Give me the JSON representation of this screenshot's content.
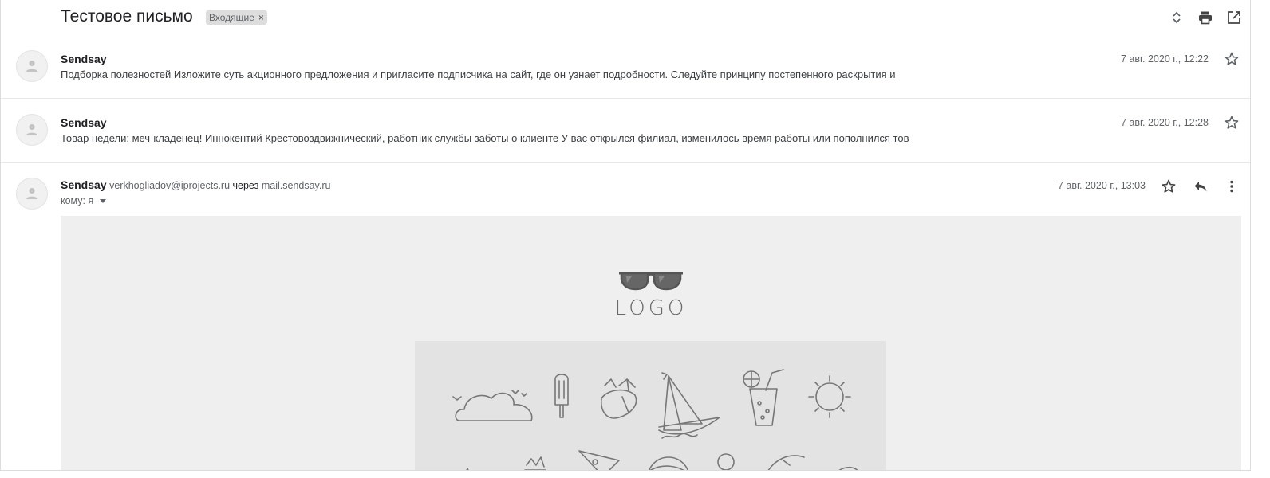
{
  "subject": "Тестовое письмо",
  "label_chip": {
    "text": "Входящие",
    "remove": "×"
  },
  "toolbar_icons": [
    "expand-collapse-icon",
    "print-icon",
    "open-new-window-icon"
  ],
  "messages": [
    {
      "sender": "Sendsay",
      "snippet": "Подборка полезностей Изложите суть акционного предложения и пригласите подписчика на сайт, где он узнает подробности. Следуйте принципу постепенного раскрытия и",
      "date": "7 авг. 2020 г., 12:22"
    },
    {
      "sender": "Sendsay",
      "snippet": "Товар недели: меч-кладенец! Иннокентий Крестовоздвижнический, работник службы заботы о клиенте У вас открылся филиал, изменилось время работы или пополнился тов",
      "date": "7 авг. 2020 г., 12:28"
    }
  ],
  "open_message": {
    "sender": "Sendsay",
    "email": "verkhogliadov@iprojects.ru",
    "via_label": "через",
    "via_domain": "mail.sendsay.ru",
    "to": "кому: я",
    "date": "7 авг. 2020 г., 13:03"
  },
  "email_content": {
    "logo_text": "LOGO"
  },
  "colors": {
    "body_bg": "#efefef",
    "banner_bg": "#e3e3e3",
    "chip_bg": "#dddddd",
    "text_primary": "#202124",
    "text_secondary": "#5f6368"
  }
}
